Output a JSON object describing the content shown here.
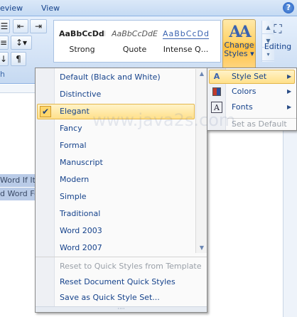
{
  "ribbon": {
    "tabs": [
      "eview",
      "View"
    ],
    "paragraph_group_label": "h",
    "gallery": [
      {
        "sample": "AaBbCcDdE",
        "name": "Strong"
      },
      {
        "sample": "AaBbCcDdE",
        "name": "Quote"
      },
      {
        "sample": "AaBbCcDd",
        "name": "Intense Q..."
      }
    ],
    "change_styles": {
      "line1": "Change",
      "line2": "Styles"
    },
    "editing": {
      "label": "Editing"
    }
  },
  "document": {
    "line1": "Word If It",
    "line2": "d Word Fo"
  },
  "style_set_menu": {
    "items": [
      "Default (Black and White)",
      "Distinctive",
      "Elegant",
      "Fancy",
      "Formal",
      "Manuscript",
      "Modern",
      "Simple",
      "Traditional",
      "Word 2003",
      "Word 2007"
    ],
    "checked_item": "Elegant",
    "reset_template": "Reset to Quick Styles from Template",
    "reset_document": "Reset Document Quick Styles",
    "save_as": "Save as Quick Style Set..."
  },
  "change_styles_menu": {
    "items": [
      {
        "label": "Style Set",
        "icon": "style-set-icon",
        "submenu": true
      },
      {
        "label": "Colors",
        "icon": "colors-icon",
        "submenu": true
      },
      {
        "label": "Fonts",
        "icon": "fonts-icon",
        "submenu": true
      }
    ],
    "set_default": "Set as Default"
  },
  "watermark": "www.java2s.com",
  "colors": {
    "highlight": "#ffe08a",
    "ribbon": "#d4e3f6",
    "text": "#15428b"
  }
}
